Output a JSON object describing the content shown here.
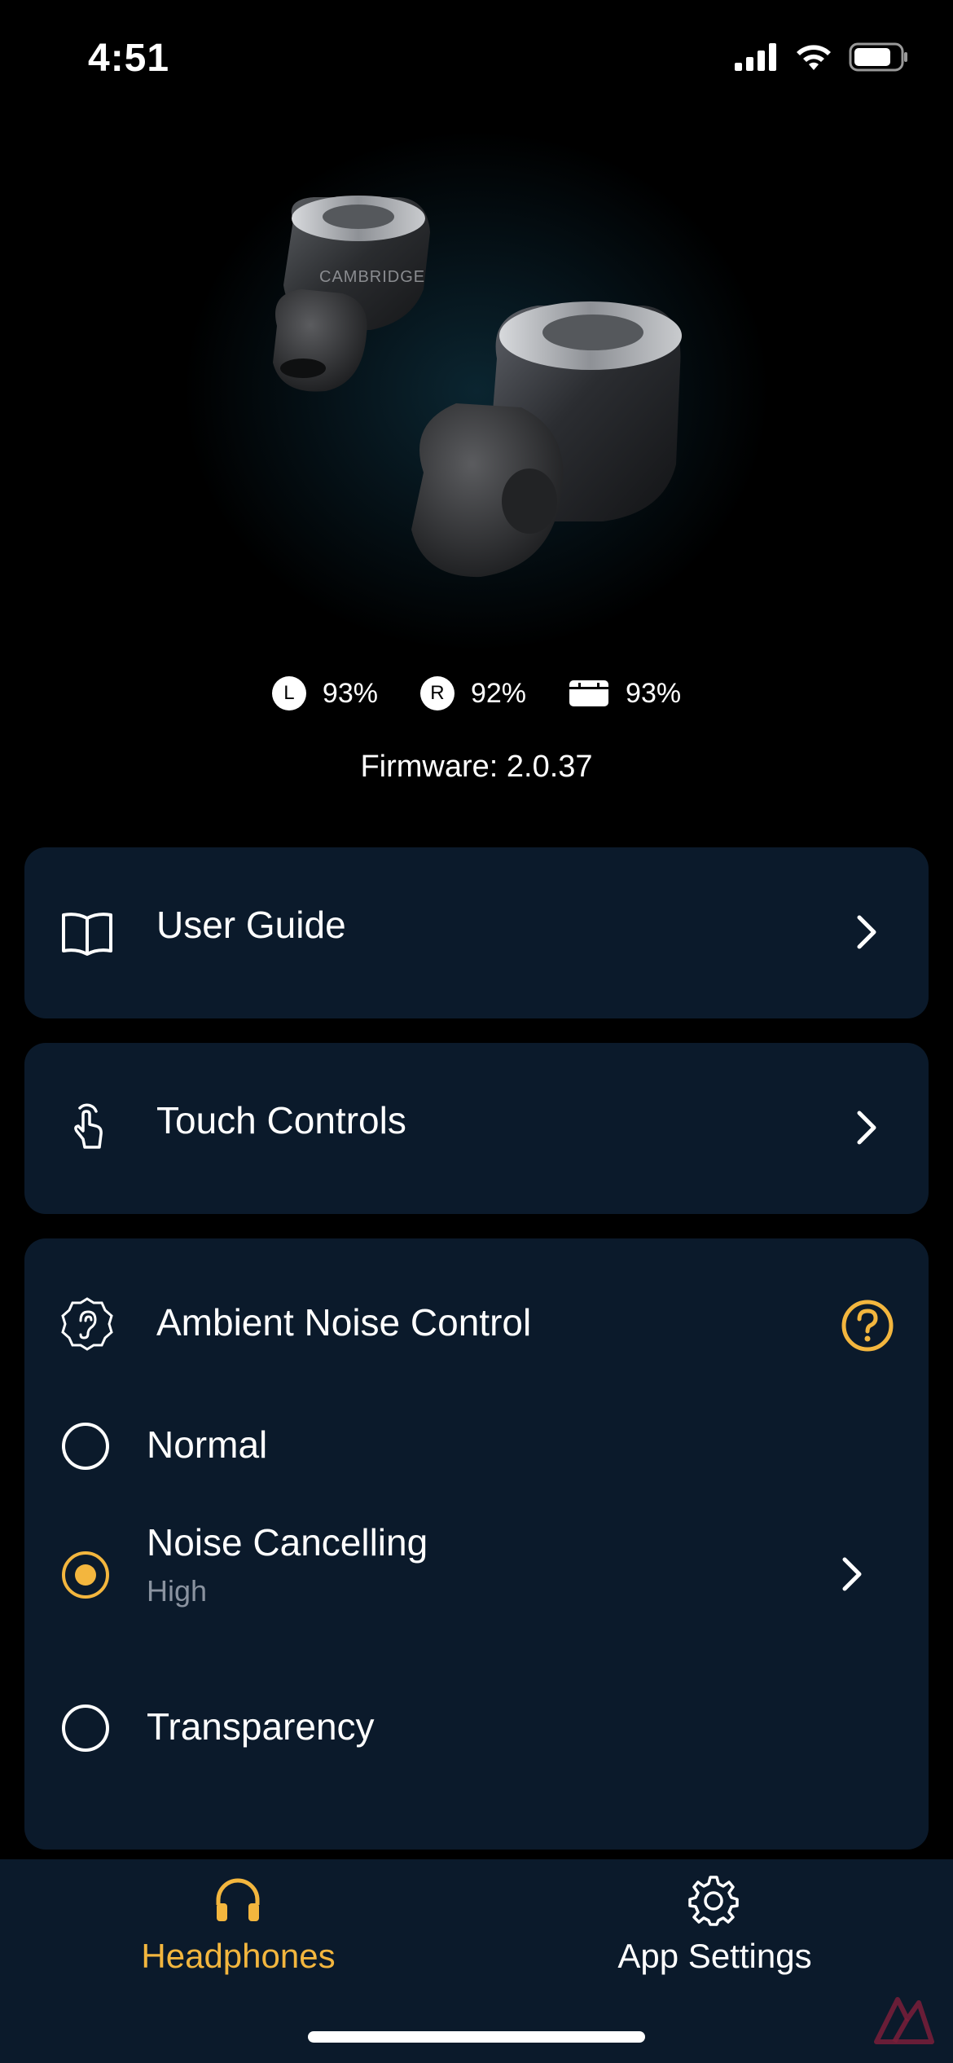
{
  "status_bar": {
    "time": "4:51"
  },
  "battery": {
    "left": {
      "badge": "L",
      "value": "93%"
    },
    "right": {
      "badge": "R",
      "value": "92%"
    },
    "case": {
      "value": "93%"
    }
  },
  "firmware": "Firmware: 2.0.37",
  "menu": {
    "user_guide": "User Guide",
    "touch_controls": "Touch Controls"
  },
  "ambient": {
    "title": "Ambient Noise Control",
    "options": [
      {
        "label": "Normal",
        "sublabel": "",
        "selected": false
      },
      {
        "label": "Noise Cancelling",
        "sublabel": "High",
        "selected": true
      },
      {
        "label": "Transparency",
        "sublabel": "",
        "selected": false
      }
    ]
  },
  "tabs": [
    {
      "label": "Headphones",
      "active": true
    },
    {
      "label": "App Settings",
      "active": false
    }
  ],
  "colors": {
    "accent": "#f3b63e",
    "card": "#0b1a2b",
    "background": "#000000"
  }
}
